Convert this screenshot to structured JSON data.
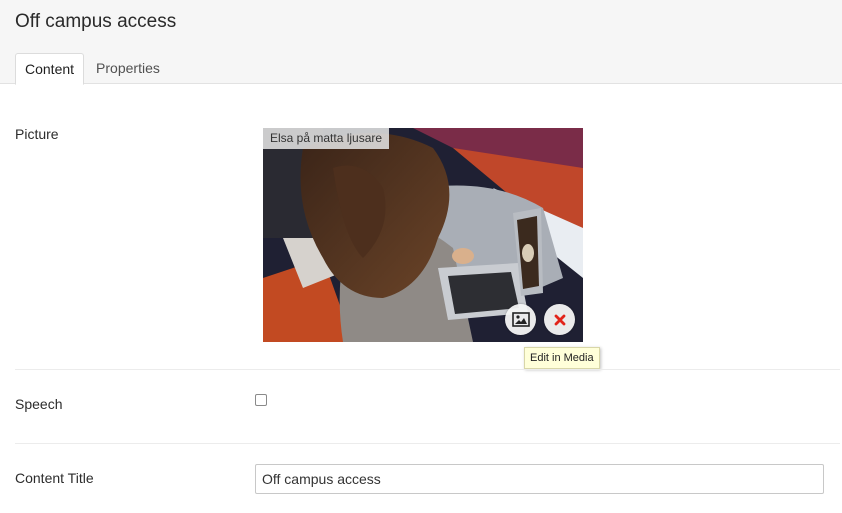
{
  "page": {
    "title": "Off campus access"
  },
  "tabs": [
    {
      "label": "Content",
      "active": true
    },
    {
      "label": "Properties",
      "active": false
    }
  ],
  "fields": {
    "picture": {
      "label": "Picture",
      "caption": "Elsa på matta ljusare",
      "edit_icon": "image-icon",
      "remove_icon": "close-icon",
      "tooltip": "Edit in Media"
    },
    "speech": {
      "label": "Speech",
      "checked": false
    },
    "content_title": {
      "label": "Content Title",
      "value": "Off campus access"
    }
  },
  "colors": {
    "remove_icon": "#e2231a",
    "tooltip_bg": "#ffffd9"
  }
}
